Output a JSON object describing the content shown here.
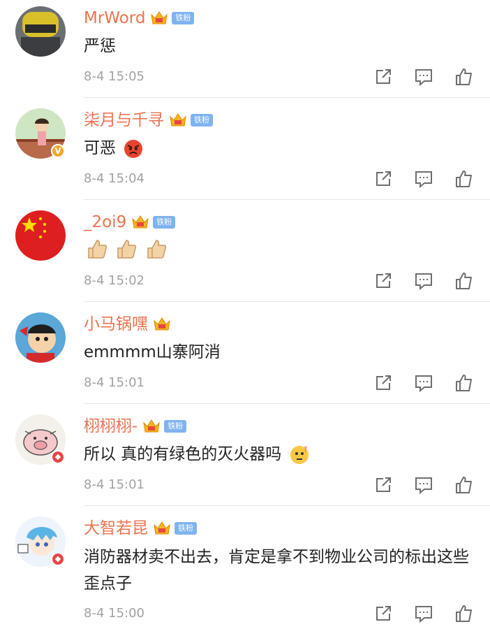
{
  "badges": {
    "fan_label": "铁粉"
  },
  "comments": [
    {
      "username": "MrWord",
      "text": "严惩",
      "time": "8-4 15:05",
      "fan": true
    },
    {
      "username": "柒月与千寻",
      "text": "可恶",
      "time": "8-4 15:04",
      "fan": true
    },
    {
      "username": "_2oi9",
      "text": "",
      "time": "8-4 15:02",
      "fan": true
    },
    {
      "username": "小马锅嘿",
      "text": "emmmm山寨阿消",
      "time": "8-4 15:01",
      "fan": false
    },
    {
      "username": "栩栩栩-",
      "text": "所以 真的有绿色的灭火器吗",
      "time": "8-4 15:01",
      "fan": true
    },
    {
      "username": "大智若昆",
      "text": "消防器材卖不出去，肯定是拿不到物业公司的标出这些歪点子",
      "time": "8-4 15:00",
      "fan": true
    }
  ],
  "colors": {
    "username": "#eb7350",
    "time": "#a2a2a2",
    "fan_badge": "#7fb3ef",
    "text": "#222222"
  },
  "icons": [
    "share-icon",
    "comment-icon",
    "like-icon",
    "crown-icon"
  ]
}
